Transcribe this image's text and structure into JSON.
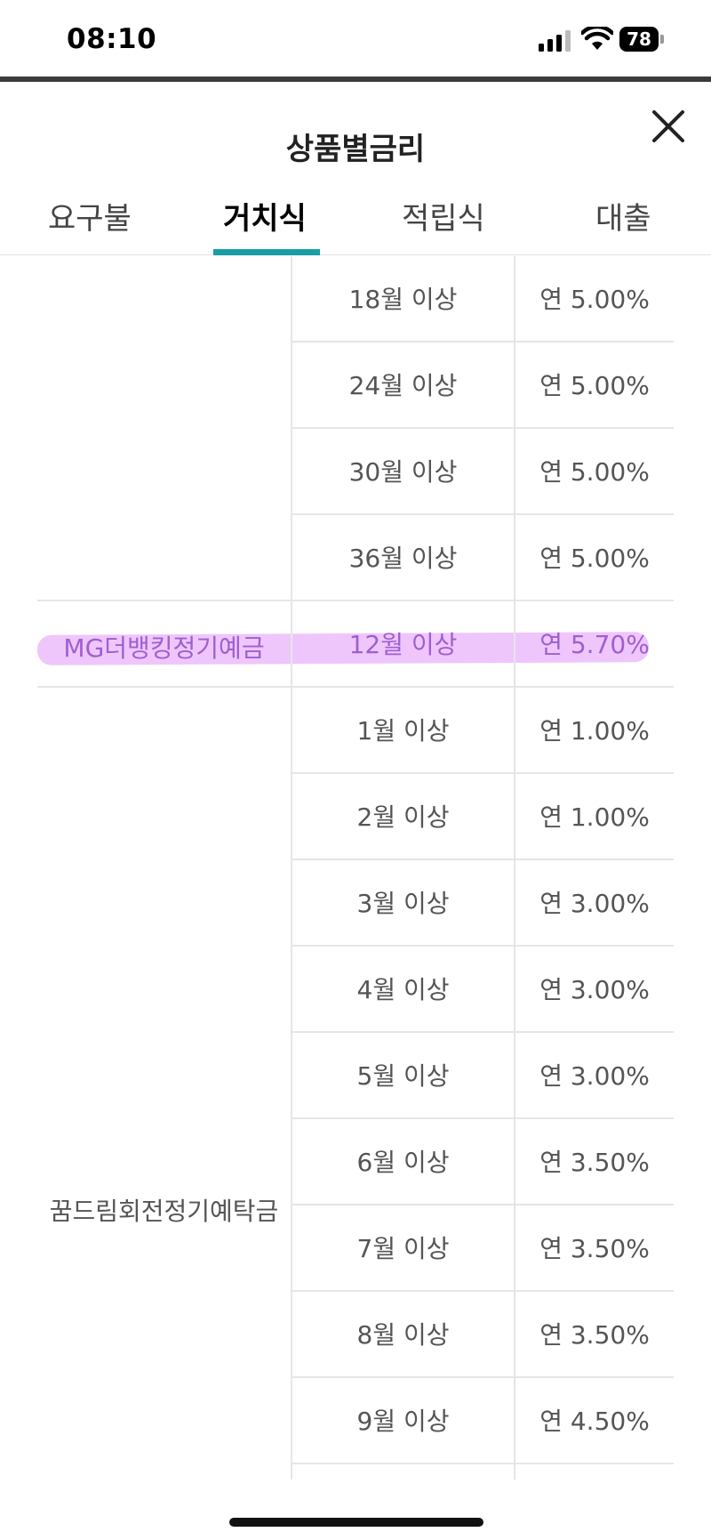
{
  "status_bar": {
    "time": "08:10",
    "battery": "78"
  },
  "header": {
    "title": "상품별금리"
  },
  "tabs": [
    {
      "label": "요구불",
      "active": false
    },
    {
      "label": "거치식",
      "active": true
    },
    {
      "label": "적립식",
      "active": false
    },
    {
      "label": "대출",
      "active": false
    }
  ],
  "colors": {
    "accent": "#1a9ea5",
    "highlight": "#d678f5"
  },
  "table": {
    "products": [
      {
        "name": "",
        "highlighted": false
      },
      {
        "name": "MG더뱅킹정기예금",
        "highlighted": true
      },
      {
        "name": "꿈드림회전정기예탁금",
        "highlighted": false
      }
    ],
    "rows": [
      {
        "period": "18월 이상",
        "rate": "연 5.00%"
      },
      {
        "period": "24월 이상",
        "rate": "연 5.00%"
      },
      {
        "period": "30월 이상",
        "rate": "연 5.00%"
      },
      {
        "period": "36월 이상",
        "rate": "연 5.00%"
      },
      {
        "period": "12월 이상",
        "rate": "연 5.70%"
      },
      {
        "period": "1월 이상",
        "rate": "연 1.00%"
      },
      {
        "period": "2월 이상",
        "rate": "연 1.00%"
      },
      {
        "period": "3월 이상",
        "rate": "연 3.00%"
      },
      {
        "period": "4월 이상",
        "rate": "연 3.00%"
      },
      {
        "period": "5월 이상",
        "rate": "연 3.00%"
      },
      {
        "period": "6월 이상",
        "rate": "연 3.50%"
      },
      {
        "period": "7월 이상",
        "rate": "연 3.50%"
      },
      {
        "period": "8월 이상",
        "rate": "연 3.50%"
      },
      {
        "period": "9월 이상",
        "rate": "연 4.50%"
      }
    ]
  }
}
